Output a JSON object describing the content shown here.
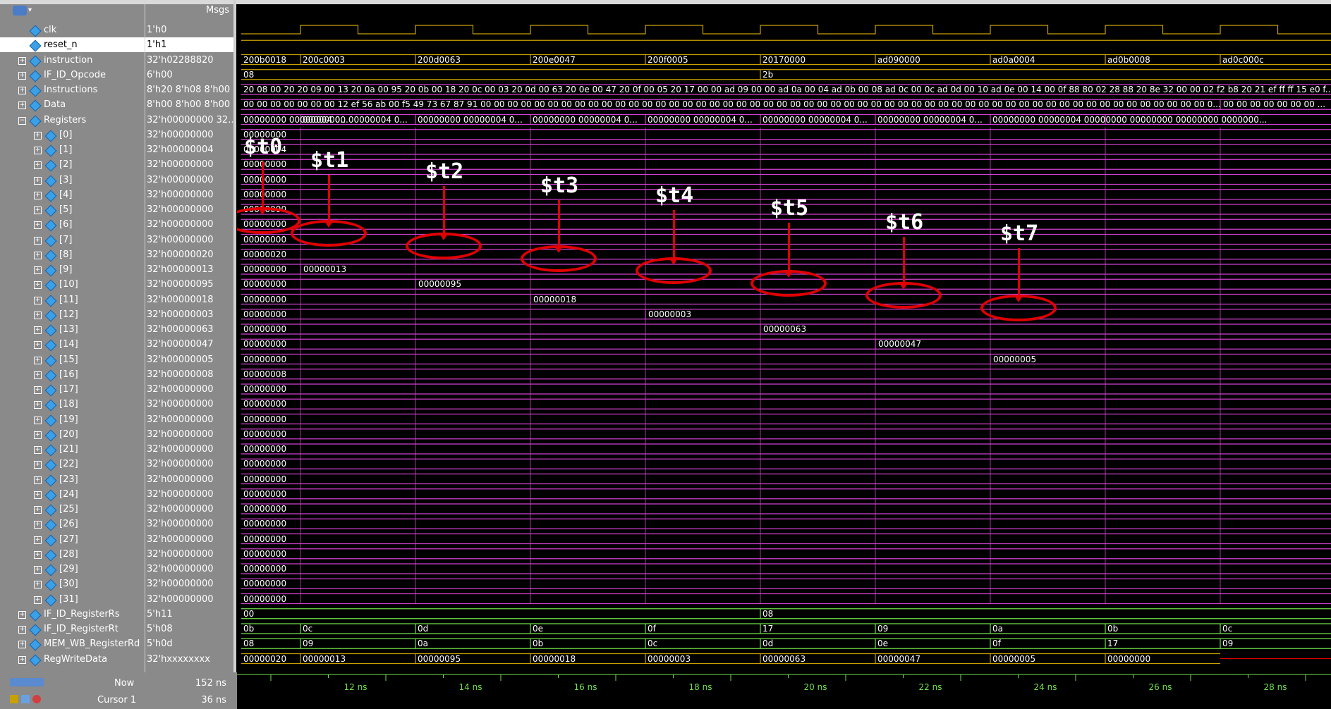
{
  "header": {
    "msgs_label": "Msgs"
  },
  "signals": [
    {
      "name": "clk",
      "value": "1'h0",
      "expand": false
    },
    {
      "name": "reset_n",
      "value": "1'h1",
      "expand": false,
      "selected": true
    },
    {
      "name": "instruction",
      "value": "32'h02288820",
      "expand": true
    },
    {
      "name": "IF_ID_Opcode",
      "value": "6'h00",
      "expand": true
    },
    {
      "name": "Instructions",
      "value": "8'h20 8'h08 8'h00 ...",
      "expand": true
    },
    {
      "name": "Data",
      "value": "8'h00 8'h00 8'h00 ...",
      "expand": true
    },
    {
      "name": "Registers",
      "value": "32'h00000000 32...",
      "expand": true,
      "expanded": true
    },
    {
      "name": "[0]",
      "value": "32'h00000000",
      "sub": true
    },
    {
      "name": "[1]",
      "value": "32'h00000004",
      "sub": true
    },
    {
      "name": "[2]",
      "value": "32'h00000000",
      "sub": true
    },
    {
      "name": "[3]",
      "value": "32'h00000000",
      "sub": true
    },
    {
      "name": "[4]",
      "value": "32'h00000000",
      "sub": true
    },
    {
      "name": "[5]",
      "value": "32'h00000000",
      "sub": true
    },
    {
      "name": "[6]",
      "value": "32'h00000000",
      "sub": true
    },
    {
      "name": "[7]",
      "value": "32'h00000000",
      "sub": true
    },
    {
      "name": "[8]",
      "value": "32'h00000020",
      "sub": true
    },
    {
      "name": "[9]",
      "value": "32'h00000013",
      "sub": true
    },
    {
      "name": "[10]",
      "value": "32'h00000095",
      "sub": true
    },
    {
      "name": "[11]",
      "value": "32'h00000018",
      "sub": true
    },
    {
      "name": "[12]",
      "value": "32'h00000003",
      "sub": true
    },
    {
      "name": "[13]",
      "value": "32'h00000063",
      "sub": true
    },
    {
      "name": "[14]",
      "value": "32'h00000047",
      "sub": true
    },
    {
      "name": "[15]",
      "value": "32'h00000005",
      "sub": true
    },
    {
      "name": "[16]",
      "value": "32'h00000008",
      "sub": true
    },
    {
      "name": "[17]",
      "value": "32'h00000000",
      "sub": true
    },
    {
      "name": "[18]",
      "value": "32'h00000000",
      "sub": true
    },
    {
      "name": "[19]",
      "value": "32'h00000000",
      "sub": true
    },
    {
      "name": "[20]",
      "value": "32'h00000000",
      "sub": true
    },
    {
      "name": "[21]",
      "value": "32'h00000000",
      "sub": true
    },
    {
      "name": "[22]",
      "value": "32'h00000000",
      "sub": true
    },
    {
      "name": "[23]",
      "value": "32'h00000000",
      "sub": true
    },
    {
      "name": "[24]",
      "value": "32'h00000000",
      "sub": true
    },
    {
      "name": "[25]",
      "value": "32'h00000000",
      "sub": true
    },
    {
      "name": "[26]",
      "value": "32'h00000000",
      "sub": true
    },
    {
      "name": "[27]",
      "value": "32'h00000000",
      "sub": true
    },
    {
      "name": "[28]",
      "value": "32'h00000000",
      "sub": true
    },
    {
      "name": "[29]",
      "value": "32'h00000000",
      "sub": true
    },
    {
      "name": "[30]",
      "value": "32'h00000000",
      "sub": true
    },
    {
      "name": "[31]",
      "value": "32'h00000000",
      "sub": true
    },
    {
      "name": "IF_ID_RegisterRs",
      "value": "5'h11",
      "expand": true
    },
    {
      "name": "IF_ID_RegisterRt",
      "value": "5'h08",
      "expand": true
    },
    {
      "name": "MEM_WB_RegisterRd",
      "value": "5'h0d",
      "expand": true
    },
    {
      "name": "RegWriteData",
      "value": "32'hxxxxxxxx",
      "expand": true
    }
  ],
  "waves": {
    "instruction": [
      "200b0018",
      "200c0003",
      "200d0063",
      "200e0047",
      "200f0005",
      "20170000",
      "ad090000",
      "ad0a0004",
      "ad0b0008",
      "ad0c000c"
    ],
    "opcode": [
      "08",
      "2b"
    ],
    "instructions_text": "20 08 00 20 20 09 00 13 20 0a 00 95 20 0b 00 18 20 0c 00 03 20 0d 00 63 20 0e 00 47 20 0f 00 05 20 17 00 00 ad 09 00 00 ad 0a 00 04 ad 0b 00 08 ad 0c 00 0c ad 0d 00 10 ad 0e 00 14 00 0f 88 80 02 28 88 20 8e 32 00 00 02 f2 b8 20 21 ef ff ff 15 e0 f...",
    "data_text": "00 00 00 00 00 00 00 12 ef 56 ab 00 f5 49 73 67 87 91 00 00 00 00 00 00 00 00 00 00 00 00 00 00 00 00 00 00 00 00 00 00 00 00 00 00 00 00 00 00 00 00 00 00 00 00 00 00 00 00 00 00 00 00 00 00 00 00 00 00 00 00 00 00 0...",
    "data_tail": "00 00 00 00 00 00 00 ...",
    "registers_segments": [
      "00000000 00000004 0...",
      "00000000 00000004 0...",
      "00000000 00000004 0...",
      "00000000 00000004 0...",
      "00000000 00000004 0...",
      "00000000 00000004 0...",
      "00000000 00000004 0...",
      "00000000 00000004 00000000 00000000 00000000 0000000..."
    ],
    "reg_default": "00000000",
    "reg1": "00000004",
    "reg16": "00000008",
    "reg_changes": [
      "00000020",
      "00000013",
      "00000095",
      "00000018",
      "00000003",
      "00000063",
      "00000047",
      "00000005"
    ],
    "rs": [
      "00",
      "08"
    ],
    "rt": [
      "0b",
      "0c",
      "0d",
      "0e",
      "0f",
      "17",
      "09",
      "0a",
      "0b",
      "0c"
    ],
    "rd": [
      "08",
      "09",
      "0a",
      "0b",
      "0c",
      "0d",
      "0e",
      "0f",
      "17",
      "09"
    ],
    "wdata": [
      "00000020",
      "00000013",
      "00000095",
      "00000018",
      "00000003",
      "00000063",
      "00000047",
      "00000005",
      "00000000"
    ]
  },
  "annotations": [
    "$t0",
    "$t1",
    "$t2",
    "$t3",
    "$t4",
    "$t5",
    "$t6",
    "$t7"
  ],
  "timeline": {
    "ticks": [
      "12 ns",
      "14 ns",
      "16 ns",
      "18 ns",
      "20 ns",
      "22 ns",
      "24 ns",
      "26 ns",
      "28 ns"
    ]
  },
  "status": {
    "now_label": "Now",
    "now_value": "152 ns",
    "cursor_label": "Cursor 1",
    "cursor_value": "36 ns"
  },
  "colors": {
    "clk": "#c8a000",
    "bus": "#d040d0",
    "green": "#6fe04a",
    "annot": "#e00000"
  }
}
